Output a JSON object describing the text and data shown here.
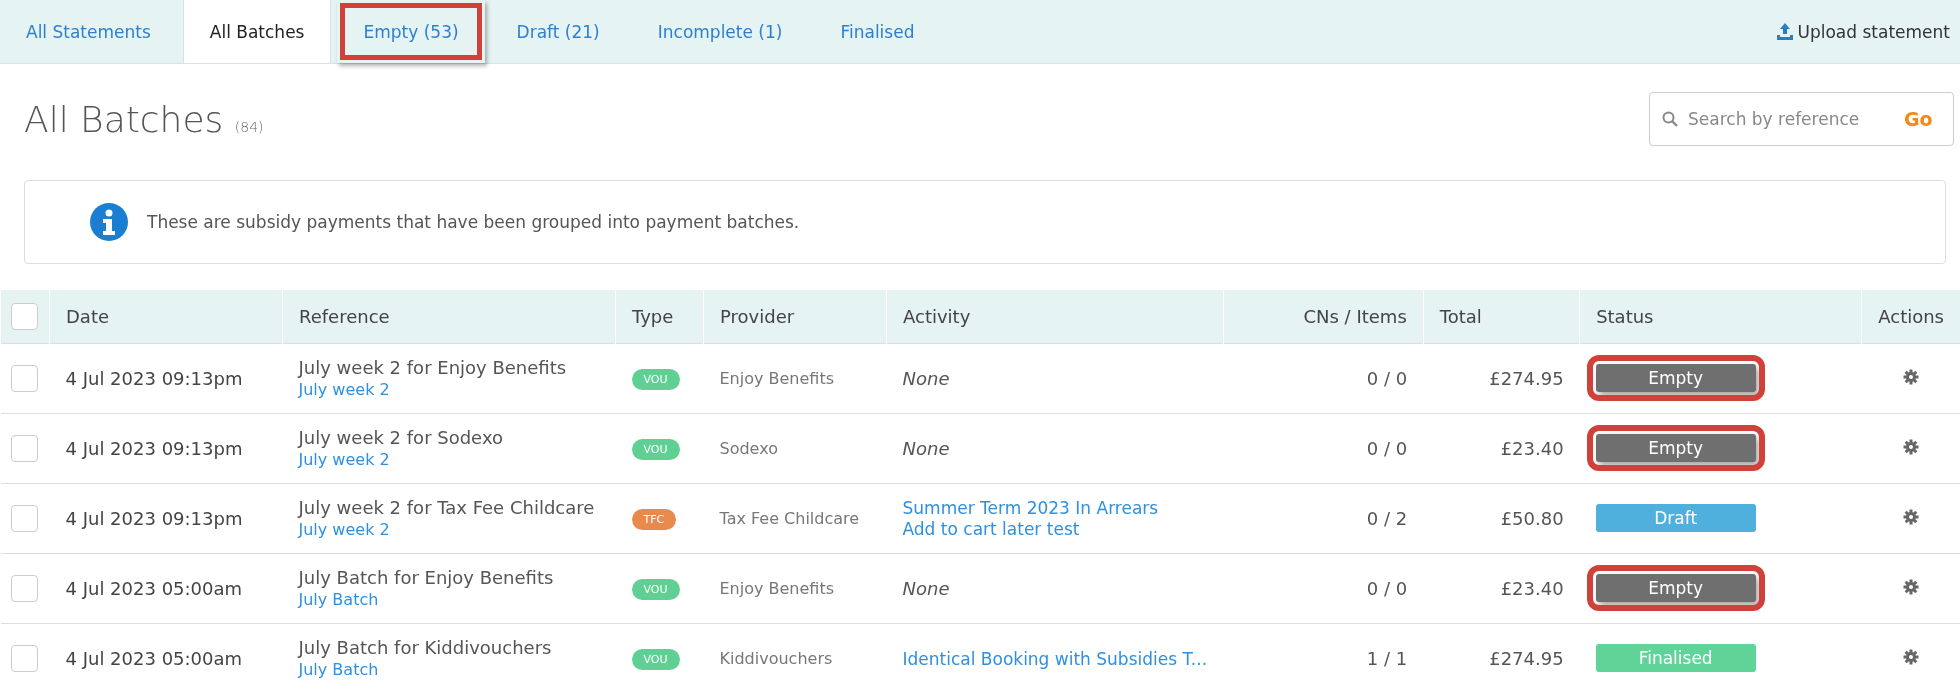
{
  "tabs": [
    {
      "label": "All Statements",
      "selected": false,
      "highlighted": false
    },
    {
      "label": "All Batches",
      "selected": true,
      "highlighted": false
    },
    {
      "label": "Empty (53)",
      "selected": false,
      "highlighted": true
    },
    {
      "label": "Draft (21)",
      "selected": false,
      "highlighted": false
    },
    {
      "label": "Incomplete (1)",
      "selected": false,
      "highlighted": false
    },
    {
      "label": "Finalised",
      "selected": false,
      "highlighted": false
    }
  ],
  "upload_button": {
    "label": "Upload statement"
  },
  "page": {
    "title": "All Batches",
    "count": "(84)"
  },
  "search": {
    "placeholder": "Search by reference",
    "button": "Go"
  },
  "info": {
    "text": "These are subsidy payments that have been grouped into payment batches."
  },
  "table": {
    "select_all": {
      "checked": false
    },
    "columns": [
      "Date",
      "Reference",
      "Type",
      "Provider",
      "Activity",
      "CNs / Items",
      "Total",
      "Status",
      "Actions"
    ],
    "rows": [
      {
        "checked": false,
        "date": "4 Jul 2023 09:13pm",
        "reference": "July week 2 for Enjoy Benefits",
        "batch": "July week 2",
        "type": {
          "label": "VOU",
          "color": "#5fcf94"
        },
        "provider": "Enjoy Benefits",
        "activity": [
          {
            "kind": "none",
            "text": "None"
          }
        ],
        "items": "0 / 0",
        "total": "£274.95",
        "status": {
          "label": "Empty",
          "kind": "empty",
          "highlighted": true
        }
      },
      {
        "checked": false,
        "date": "4 Jul 2023 09:13pm",
        "reference": "July week 2 for Sodexo",
        "batch": "July week 2",
        "type": {
          "label": "VOU",
          "color": "#5fcf94"
        },
        "provider": "Sodexo",
        "activity": [
          {
            "kind": "none",
            "text": "None"
          }
        ],
        "items": "0 / 0",
        "total": "£23.40",
        "status": {
          "label": "Empty",
          "kind": "empty",
          "highlighted": true
        }
      },
      {
        "checked": false,
        "date": "4 Jul 2023 09:13pm",
        "reference": "July week 2 for Tax Fee Childcare",
        "batch": "July week 2",
        "type": {
          "label": "TFC",
          "color": "#e88a4e"
        },
        "provider": "Tax Fee Childcare",
        "activity": [
          {
            "kind": "link",
            "text": "Summer Term 2023 In Arrears"
          },
          {
            "kind": "link",
            "text": "Add to cart later test"
          }
        ],
        "items": "0 / 2",
        "total": "£50.80",
        "status": {
          "label": "Draft",
          "kind": "draft",
          "highlighted": false
        }
      },
      {
        "checked": false,
        "date": "4 Jul 2023 05:00am",
        "reference": "July Batch for Enjoy Benefits",
        "batch": "July Batch",
        "type": {
          "label": "VOU",
          "color": "#5fcf94"
        },
        "provider": "Enjoy Benefits",
        "activity": [
          {
            "kind": "none",
            "text": "None"
          }
        ],
        "items": "0 / 0",
        "total": "£23.40",
        "status": {
          "label": "Empty",
          "kind": "empty",
          "highlighted": true
        }
      },
      {
        "checked": false,
        "date": "4 Jul 2023 05:00am",
        "reference": "July Batch for Kiddivouchers",
        "batch": "July Batch",
        "type": {
          "label": "VOU",
          "color": "#5fcf94"
        },
        "provider": "Kiddivouchers",
        "activity": [
          {
            "kind": "link",
            "text": "Identical Booking with Subsidies T..."
          }
        ],
        "items": "1 / 1",
        "total": "£274.95",
        "status": {
          "label": "Finalised",
          "kind": "finalised",
          "highlighted": false
        }
      }
    ]
  }
}
